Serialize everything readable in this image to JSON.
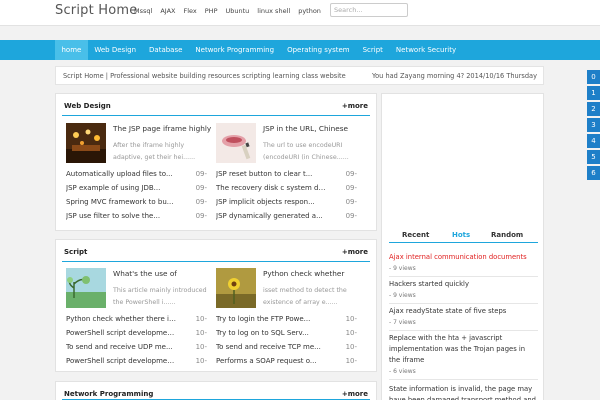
{
  "header": {
    "logo": "Script Home",
    "nav": [
      "Mssql",
      "AJAX",
      "Flex",
      "PHP",
      "Ubuntu",
      "linux shell",
      "python"
    ],
    "search_placeholder": "Search..."
  },
  "mainnav": [
    "home",
    "Web Design",
    "Database",
    "Network Programming",
    "Operating system",
    "Script",
    "Network Security"
  ],
  "infobar": {
    "left": "Script Home | Professional website building resources scripting learning class website",
    "right": "You had Zayang morning 4? 2014/10/16 Thursday"
  },
  "side_numbers": [
    "0",
    "1",
    "2",
    "3",
    "4",
    "5",
    "6"
  ],
  "panels": [
    {
      "title": "Web Design",
      "more": "+more",
      "features": [
        {
          "title": "The JSP page iframe highly",
          "desc": "After the iframe highly adaptive, get their hei......"
        },
        {
          "title": "JSP in the URL, Chinese",
          "desc": "The url to use encodeURI (encodeURI (in Chinese......"
        }
      ],
      "lists": [
        [
          {
            "title": "Automatically upload files to...",
            "date": "09-"
          },
          {
            "title": "JSP example of using JDB...",
            "date": "09-"
          },
          {
            "title": "Spring MVC framework to bu...",
            "date": "09-"
          },
          {
            "title": "JSP use filter to solve the...",
            "date": "09-"
          }
        ],
        [
          {
            "title": "JSP reset button to clear t...",
            "date": "09-"
          },
          {
            "title": "The recovery disk c system de...",
            "date": "09-"
          },
          {
            "title": "JSP implicit objects respon...",
            "date": "09-"
          },
          {
            "title": "JSP dynamically generated a...",
            "date": "09-"
          }
        ]
      ]
    },
    {
      "title": "Script",
      "more": "+more",
      "features": [
        {
          "title": "What's the use of",
          "desc": "This article mainly introduced the PowerShell i......"
        },
        {
          "title": "Python check whether",
          "desc": "isset method to detect the existence of array e......"
        }
      ],
      "lists": [
        [
          {
            "title": "Python check whether there is...",
            "date": "10-"
          },
          {
            "title": "PowerShell script developmen...",
            "date": "10-"
          },
          {
            "title": "To send and receive UDP me...",
            "date": "10-"
          },
          {
            "title": "PowerShell script developmen...",
            "date": "10-"
          }
        ],
        [
          {
            "title": "Try to login the FTP Powe...",
            "date": "10-"
          },
          {
            "title": "Try to log on to SQL Serv...",
            "date": "10-"
          },
          {
            "title": "To send and receive TCP me...",
            "date": "10-"
          },
          {
            "title": "Performs a SOAP request o...",
            "date": "10-"
          }
        ]
      ]
    },
    {
      "title": "Network Programming",
      "more": "+more"
    }
  ],
  "sidebar": {
    "tabs": [
      "Recent",
      "Hots",
      "Random"
    ],
    "active_tab": "Hots",
    "items": [
      {
        "title": "Ajax internal communication documents",
        "views": "- 9 views",
        "highlight": true
      },
      {
        "title": "Hackers started quickly",
        "views": "- 9 views",
        "highlight": false
      },
      {
        "title": "Ajax readyState state of five steps",
        "views": "- 7 views",
        "highlight": false
      },
      {
        "title": "Replace with the hta + javascript implementation was the Trojan pages in the iframe",
        "views": "- 6 views",
        "highlight": false
      },
      {
        "title": "State information is invalid, the page may have been damaged transport method and",
        "views": "",
        "highlight": false
      }
    ]
  },
  "colors": {
    "accent": "#1ea6dc",
    "active_nav": "#49bfe9",
    "side_number_bg": "#1e7fc8",
    "highlight_text": "#e02020"
  }
}
